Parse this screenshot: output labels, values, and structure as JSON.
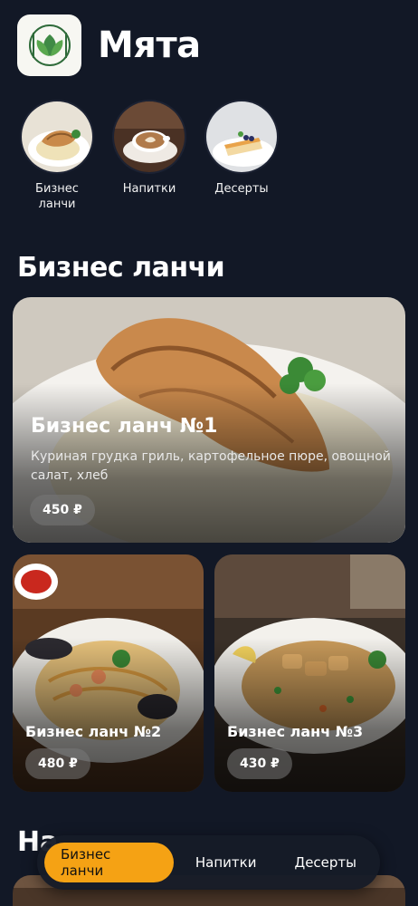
{
  "app": {
    "title": "Мята"
  },
  "categories": [
    {
      "label": "Бизнес\nланчи",
      "icon": "grilled-chicken-image"
    },
    {
      "label": "Напитки",
      "icon": "coffee-cup-image"
    },
    {
      "label": "Десерты",
      "icon": "cheesecake-image"
    }
  ],
  "section": {
    "title": "Бизнес ланчи"
  },
  "lunches": [
    {
      "title": "Бизнес ланч №1",
      "description": "Куриная грудка гриль, картофельное пюре, овощной салат, хлеб",
      "price": "450 ₽"
    },
    {
      "title": "Бизнес ланч №2",
      "price": "480 ₽"
    },
    {
      "title": "Бизнес ланч №3",
      "price": "430 ₽"
    }
  ],
  "next_section": {
    "title_partial": "На"
  },
  "tabbar": {
    "tabs": [
      {
        "label": "Бизнес ланчи",
        "active": true
      },
      {
        "label": "Напитки",
        "active": false
      },
      {
        "label": "Десерты",
        "active": false
      }
    ]
  },
  "colors": {
    "background": "#121826",
    "accent": "#f5a214"
  }
}
